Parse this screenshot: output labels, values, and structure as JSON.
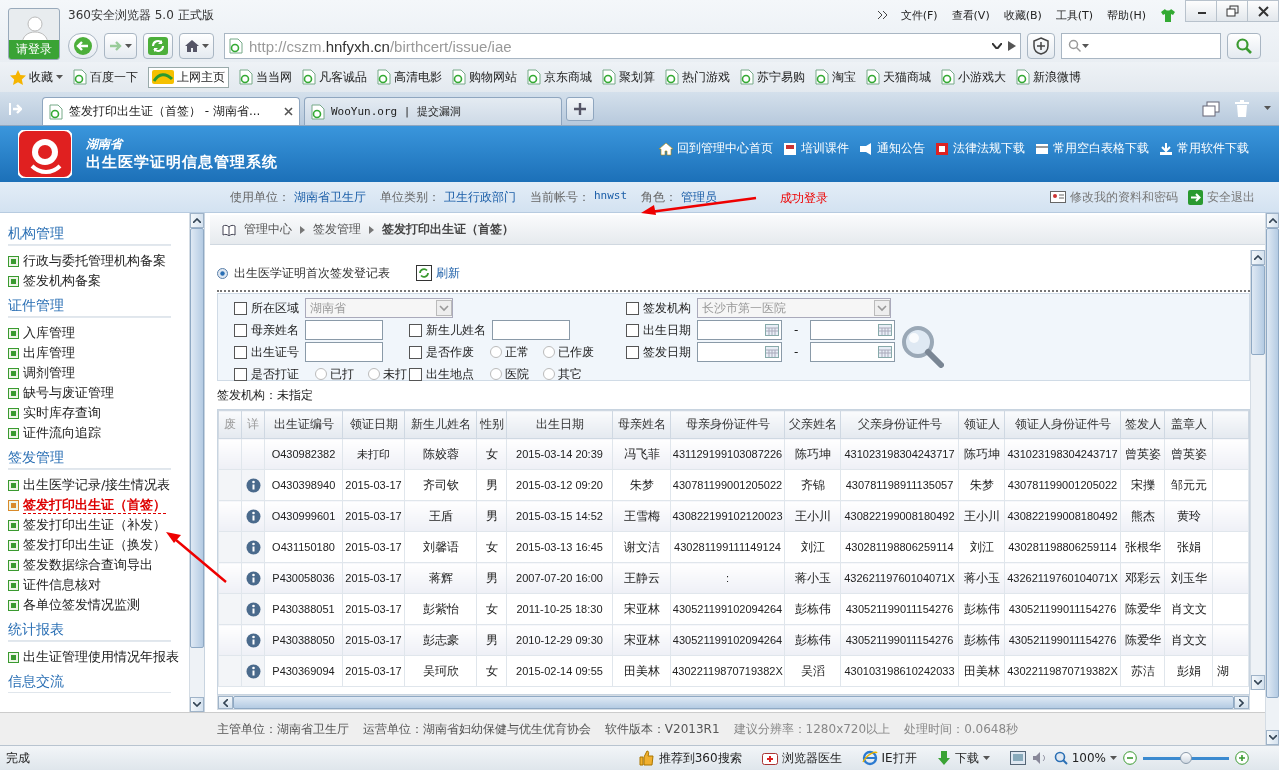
{
  "browser": {
    "title": "360安全浏览器 5.0 正式版",
    "login": "请登录",
    "menu": [
      "文件(F)",
      "查看(V)",
      "收藏(B)",
      "工具(T)",
      "帮助(H)"
    ],
    "url": [
      {
        "text": "http://cszm.",
        "emphasis": false
      },
      {
        "text": "hnfyxh.cn",
        "emphasis": true
      },
      {
        "text": "/birthcert/issue/iae",
        "emphasis": false
      }
    ],
    "favorites_label": "收藏",
    "bookmarks": [
      {
        "label": "百度一下",
        "kind": "page"
      },
      {
        "label": "上网主页",
        "kind": "home"
      },
      {
        "label": "当当网",
        "kind": "page"
      },
      {
        "label": "凡客诚品",
        "kind": "page"
      },
      {
        "label": "高清电影",
        "kind": "page"
      },
      {
        "label": "购物网站",
        "kind": "page"
      },
      {
        "label": "京东商城",
        "kind": "page"
      },
      {
        "label": "聚划算",
        "kind": "page"
      },
      {
        "label": "热门游戏",
        "kind": "page"
      },
      {
        "label": "苏宁易购",
        "kind": "page"
      },
      {
        "label": "淘宝",
        "kind": "page"
      },
      {
        "label": "天猫商城",
        "kind": "page"
      },
      {
        "label": "小游戏大",
        "kind": "page"
      },
      {
        "label": "新浪微博",
        "kind": "page"
      }
    ],
    "tabs": [
      {
        "title": "签发打印出生证（首签） - 湖南省...",
        "selected": true
      },
      {
        "title": "WooYun.org | 提交漏洞",
        "selected": false
      }
    ],
    "status": "完成",
    "status_items": [
      {
        "kind": "thumb",
        "label": "推荐到360搜索"
      },
      {
        "kind": "doctor",
        "label": "浏览器医生"
      },
      {
        "kind": "ie",
        "label": "IE打开"
      },
      {
        "kind": "download",
        "label": "下载"
      }
    ],
    "zoom": "100%",
    "zoom_slider": {
      "level": 0.5
    }
  },
  "system": {
    "province": "湖南省",
    "title": "出生医学证明信息管理系统",
    "links": [
      {
        "kind": "home",
        "label": "回到管理中心首页"
      },
      {
        "kind": "course",
        "label": "培训课件"
      },
      {
        "kind": "notice",
        "label": "通知公告"
      },
      {
        "kind": "law",
        "label": "法律法规下载"
      },
      {
        "kind": "form",
        "label": "常用空白表格下载"
      },
      {
        "kind": "software",
        "label": "常用软件下载"
      }
    ]
  },
  "user_info": [
    {
      "label": "使用单位：",
      "value": "湖南省卫生厅"
    },
    {
      "label": "单位类别：",
      "value": "卫生行政部门"
    },
    {
      "label": "当前帐号：",
      "value": "hnwst"
    },
    {
      "label": "角色：",
      "value": "管理员"
    }
  ],
  "account_links": [
    {
      "kind": "profile",
      "label": "修改我的资料和密码"
    },
    {
      "kind": "logout",
      "label": "安全退出"
    }
  ],
  "annotations": [
    {
      "kind": "label",
      "text": "成功登录"
    },
    {
      "kind": "arrow"
    },
    {
      "kind": "arrow"
    }
  ],
  "sidebar": {
    "groups": [
      {
        "title": "机构管理",
        "items": [
          {
            "label": "行政与委托管理机构备案",
            "selected": false
          },
          {
            "label": "签发机构备案",
            "selected": false
          }
        ]
      },
      {
        "title": "证件管理",
        "items": [
          {
            "label": "入库管理",
            "selected": false
          },
          {
            "label": "出库管理",
            "selected": false
          },
          {
            "label": "调剂管理",
            "selected": false
          },
          {
            "label": "缺号与废证管理",
            "selected": false
          },
          {
            "label": "实时库存查询",
            "selected": false
          },
          {
            "label": "证件流向追踪",
            "selected": false
          }
        ]
      },
      {
        "title": "签发管理",
        "items": [
          {
            "label": "出生医学记录/接生情况表",
            "selected": false
          },
          {
            "label": "签发打印出生证（首签）",
            "selected": true
          },
          {
            "label": "签发打印出生证（补发）",
            "selected": false
          },
          {
            "label": "签发打印出生证（换发）",
            "selected": false
          },
          {
            "label": "签发数据综合查询导出",
            "selected": false
          },
          {
            "label": "证件信息核对",
            "selected": false
          },
          {
            "label": "各单位签发情况监测",
            "selected": false
          }
        ]
      },
      {
        "title": "统计报表",
        "items": [
          {
            "label": "出生证管理使用情况年报表",
            "selected": false
          }
        ]
      },
      {
        "title": "信息交流"
      }
    ]
  },
  "breadcrumb": [
    "管理中心",
    "签发管理",
    "签发打印出生证（首签）"
  ],
  "panel": {
    "title": "出生医学证明首次签发登记表",
    "refresh": "刷新"
  },
  "search_form": {
    "fields": [
      {
        "kind": "select",
        "label": "所在区域",
        "checked": false,
        "value": "湖南省",
        "disabled": true
      },
      {
        "kind": "select",
        "label": "签发机构",
        "checked": false,
        "value": "长沙市第一医院",
        "disabled": true
      },
      {
        "kind": "text",
        "label": "母亲姓名",
        "checked": false
      },
      {
        "kind": "text",
        "label": "新生儿姓名",
        "checked": false
      },
      {
        "kind": "date_range",
        "label": "出生日期",
        "checked": false,
        "separator": "-"
      },
      {
        "kind": "text",
        "label": "出生证号",
        "checked": false
      },
      {
        "kind": "radios",
        "label": "是否作废",
        "checked": false,
        "options": [
          {
            "label": "正常",
            "selected": false
          },
          {
            "label": "已作废",
            "selected": false
          }
        ]
      },
      {
        "kind": "date_range",
        "label": "签发日期",
        "checked": false,
        "separator": "-"
      },
      {
        "kind": "radios",
        "label": "是否打证",
        "checked": false,
        "options": [
          {
            "label": "已打",
            "selected": false
          },
          {
            "label": "未打",
            "selected": false
          }
        ]
      },
      {
        "kind": "radios",
        "label": "出生地点",
        "checked": false,
        "options": [
          {
            "label": "医院",
            "selected": false
          },
          {
            "label": "其它",
            "selected": false
          }
        ]
      }
    ]
  },
  "issuer_filter": "签发机构：未指定",
  "table": {
    "columns": [
      "废",
      "详",
      "出生证编号",
      "领证日期",
      "新生儿姓名",
      "性别",
      "出生日期",
      "母亲姓名",
      "母亲身份证件号",
      "父亲姓名",
      "父亲身份证件号",
      "领证人",
      "领证人身份证件号",
      "签发人",
      "盖章人"
    ],
    "rows": [
      {
        "details": false,
        "cells": [
          "",
          "",
          "O430982382",
          "未打印",
          "陈姣蓉",
          "女",
          "2015-03-14 20:39",
          "冯飞菲",
          "431129199103087226",
          "陈巧坤",
          "431023198304243717",
          "陈巧坤",
          "431023198304243717",
          "曾英姿",
          "曾英姿"
        ]
      },
      {
        "details": true,
        "cells": [
          "",
          "",
          "O430398940",
          "2015-03-17",
          "齐司钦",
          "男",
          "2015-03-12 09:20",
          "朱梦",
          "430781199001205022",
          "齐锦",
          "430781198911135057",
          "朱梦",
          "430781199001205022",
          "宋擽",
          "邹元元"
        ]
      },
      {
        "details": true,
        "cells": [
          "",
          "",
          "O430999601",
          "2015-03-17",
          "王盾",
          "男",
          "2015-03-15 14:52",
          "王雪梅",
          "430822199102120023",
          "王小川",
          "430822199008180492",
          "王小川",
          "430822199008180492",
          "熊杰",
          "黄玲"
        ]
      },
      {
        "details": true,
        "cells": [
          "",
          "",
          "O431150180",
          "2015-03-17",
          "刘馨语",
          "女",
          "2015-03-13 16:45",
          "谢文洁",
          "430281199111149124",
          "刘江",
          "430281198806259114",
          "刘江",
          "430281198806259114",
          "张根华",
          "张娟"
        ]
      },
      {
        "details": true,
        "cells": [
          "",
          "",
          "P430058036",
          "2015-03-17",
          "蒋辉",
          "男",
          "2007-07-20 16:00",
          "王静云",
          ":",
          "蒋小玉",
          "43262119760104071X",
          "蒋小玉",
          "43262119760104071X",
          "邓彩云",
          "刘玉华"
        ]
      },
      {
        "details": true,
        "cells": [
          "",
          "",
          "P430388051",
          "2015-03-17",
          "彭紫怡",
          "女",
          "2011-10-25 18:30",
          "宋亚林",
          "430521199102094264",
          "彭栋伟",
          "430521199011154276",
          "彭栋伟",
          "430521199011154276",
          "陈爱华",
          "肖文文"
        ]
      },
      {
        "details": true,
        "cells": [
          "",
          "",
          "P430388050",
          "2015-03-17",
          "彭志豪",
          "男",
          "2010-12-29 09:30",
          "宋亚林",
          "430521199102094264",
          "彭栋伟",
          "430521199011154276",
          "彭栋伟",
          "430521199011154276",
          "陈爱华",
          "肖文文"
        ]
      },
      {
        "details": true,
        "cells": [
          "",
          "",
          "P430369094",
          "2015-03-17",
          "吴珂欣",
          "女",
          "2015-02-14 09:55",
          "田美林",
          "43022119870719382X",
          "吴滔",
          "430103198610242033",
          "田美林",
          "43022119870719382X",
          "苏洁",
          "彭娟"
        ],
        "column_16": "湖"
      }
    ]
  },
  "footer": [
    "主管单位：湖南省卫生厅",
    "运营单位：湖南省妇幼保健与优生优育协会",
    "软件版本：V2013R1",
    "建议分辨率：1280x720以上",
    "处理时间：0.0648秒"
  ]
}
